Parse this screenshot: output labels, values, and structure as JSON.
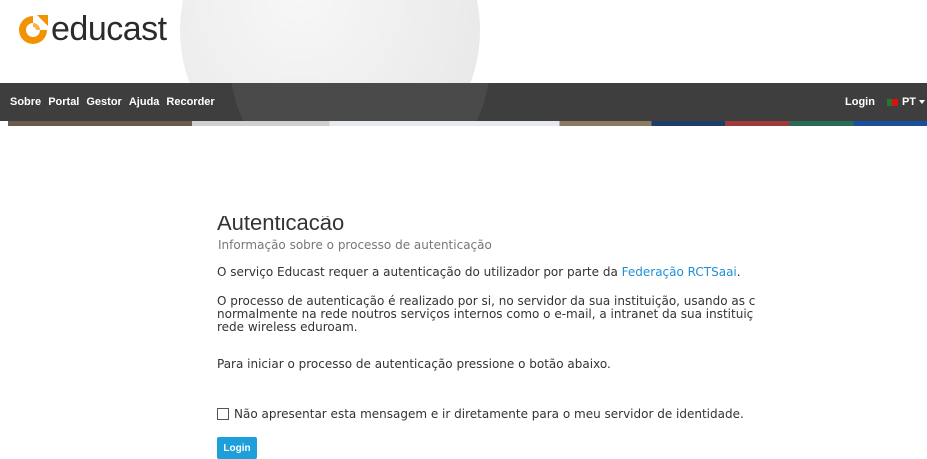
{
  "brand": {
    "name": "educast"
  },
  "nav": {
    "items": [
      {
        "label": "Sobre"
      },
      {
        "label": "Portal"
      },
      {
        "label": "Gestor"
      },
      {
        "label": "Ajuda"
      },
      {
        "label": "Recorder"
      }
    ],
    "login_label": "Login",
    "language": "PT"
  },
  "content": {
    "title": "Autenticação",
    "subtitle": "Informação sobre o processo de autenticação",
    "p1_text": "O serviço Educast requer a autenticação do utilizador por parte da ",
    "p1_link": "Federação RCTSaai",
    "p1_end": ".",
    "p2_line1": "O processo de autenticação é realizado por si, no servidor da sua instituição, usando as c",
    "p2_line2": "normalmente na rede noutros serviços internos como o e-mail, a intranet da sua instituiç",
    "p2_line3": "rede wireless eduroam.",
    "p3": "Para iniciar o processo de autenticação pressione o botão abaixo.",
    "checkbox_label": "Não apresentar esta mensagem e ir diretamente para o meu servidor de identidade.",
    "checkbox_checked": false,
    "button_label": "Login"
  },
  "colors": {
    "nav_bg": "#3e3e3e",
    "accent": "#1c9fdb",
    "link": "#1e90d6",
    "logo_orange": "#f39200"
  }
}
